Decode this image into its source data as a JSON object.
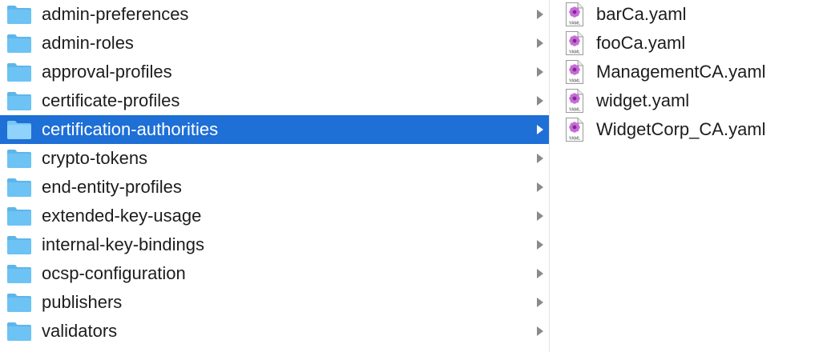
{
  "folders": [
    {
      "name": "admin-preferences",
      "selected": false
    },
    {
      "name": "admin-roles",
      "selected": false
    },
    {
      "name": "approval-profiles",
      "selected": false
    },
    {
      "name": "certificate-profiles",
      "selected": false
    },
    {
      "name": "certification-authorities",
      "selected": true
    },
    {
      "name": "crypto-tokens",
      "selected": false
    },
    {
      "name": "end-entity-profiles",
      "selected": false
    },
    {
      "name": "extended-key-usage",
      "selected": false
    },
    {
      "name": "internal-key-bindings",
      "selected": false
    },
    {
      "name": "ocsp-configuration",
      "selected": false
    },
    {
      "name": "publishers",
      "selected": false
    },
    {
      "name": "validators",
      "selected": false
    }
  ],
  "files": [
    {
      "name": "barCa.yaml",
      "badge": "YAML"
    },
    {
      "name": "fooCa.yaml",
      "badge": "YAML"
    },
    {
      "name": "ManagementCA.yaml",
      "badge": "YAML"
    },
    {
      "name": "widget.yaml",
      "badge": "YAML"
    },
    {
      "name": "WidgetCorp_CA.yaml",
      "badge": "YAML"
    }
  ],
  "colors": {
    "selection": "#1e6fd6",
    "folder": "#6cc3f4",
    "chevron": "#8a8a8a"
  },
  "icons": {
    "folder": "folder-icon",
    "chevron": "chevron-right-icon",
    "file": "yaml-file-icon"
  }
}
